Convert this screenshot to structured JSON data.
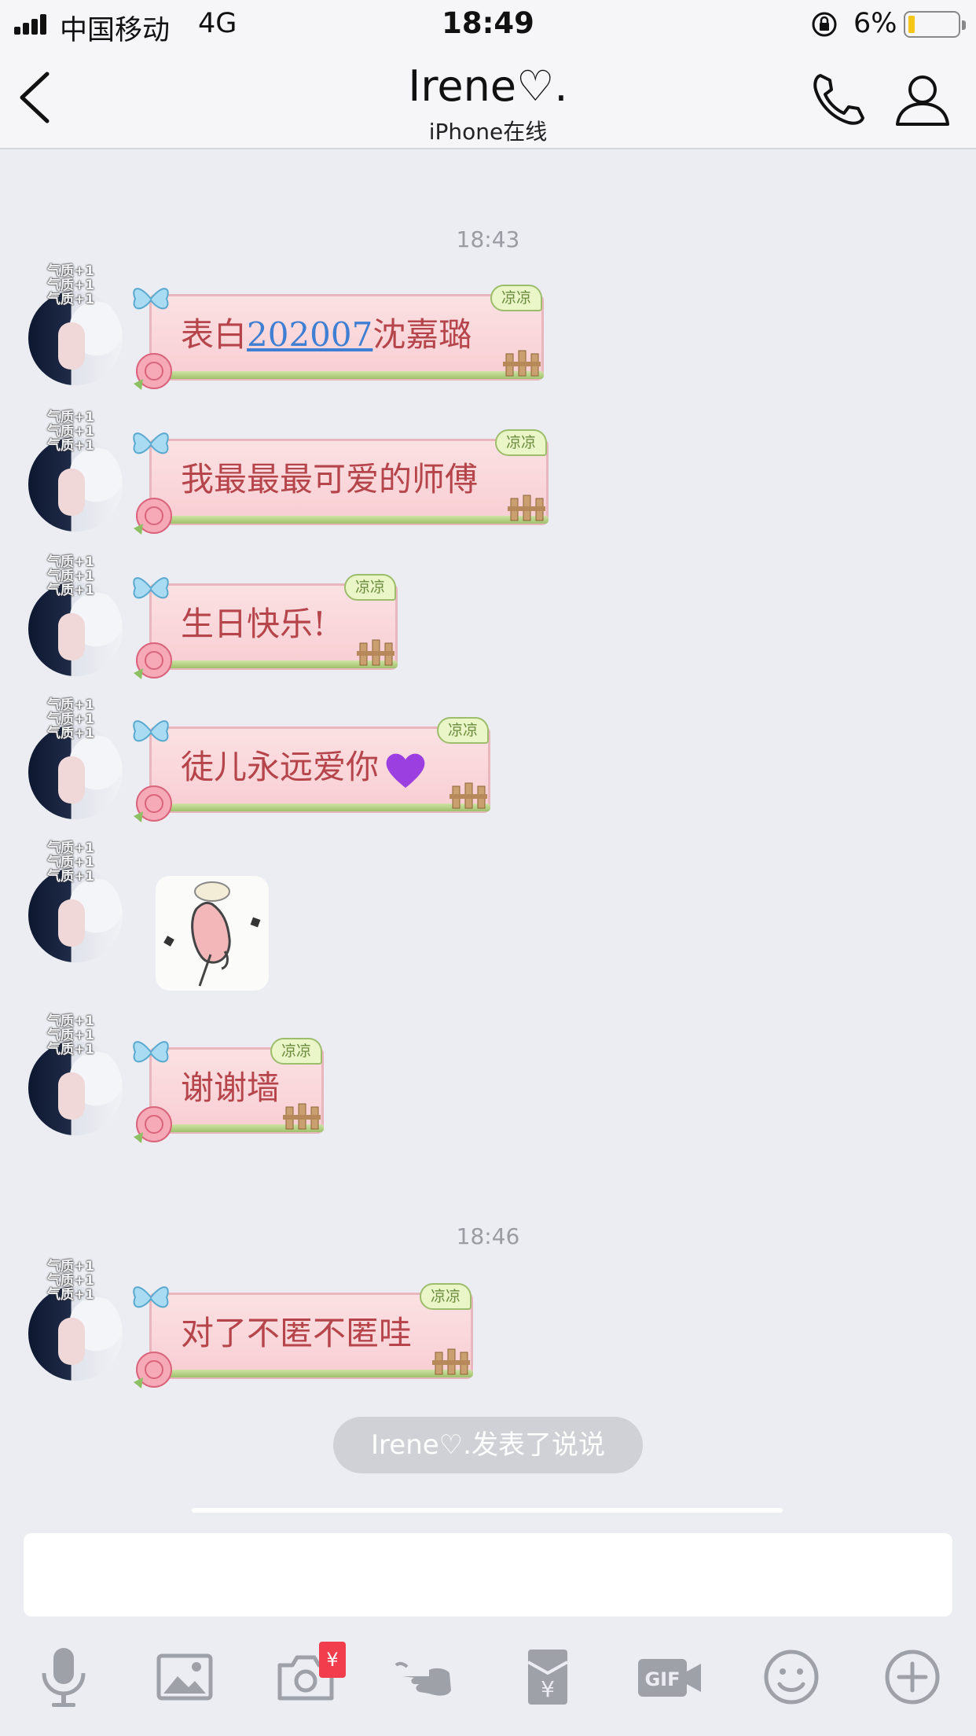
{
  "status_bar": {
    "carrier": "中国移动",
    "network": "4G",
    "time": "18:49",
    "battery": "6%",
    "battery_level": 0.06
  },
  "nav": {
    "title": "Irene♡.",
    "subtitle": "iPhone在线"
  },
  "avatar": {
    "tag_lines": [
      "气质+1",
      "气质+1",
      "气质+1"
    ]
  },
  "bubble_sticker": {
    "leaf_label": "凉凉"
  },
  "timestamps": [
    "18:43",
    "18:46"
  ],
  "messages": [
    {
      "prefix": "表白",
      "link": "202007",
      "suffix": "沈嘉璐"
    },
    {
      "text": "我最最最可爱的师傅"
    },
    {
      "text": "生日快乐!"
    },
    {
      "text": "徒儿永远爱你"
    },
    {
      "text": "谢谢墙"
    },
    {
      "text": "对了不匿不匿哇"
    }
  ],
  "system_notice": "Irene♡.发表了说说",
  "input": {
    "value": "",
    "placeholder": ""
  },
  "toolbar": {
    "icons": [
      "microphone-icon",
      "image-icon",
      "camera-icon",
      "poke-icon",
      "red-packet-icon",
      "gif-icon",
      "emoji-icon",
      "plus-icon"
    ],
    "red_packet_badge": "¥"
  }
}
